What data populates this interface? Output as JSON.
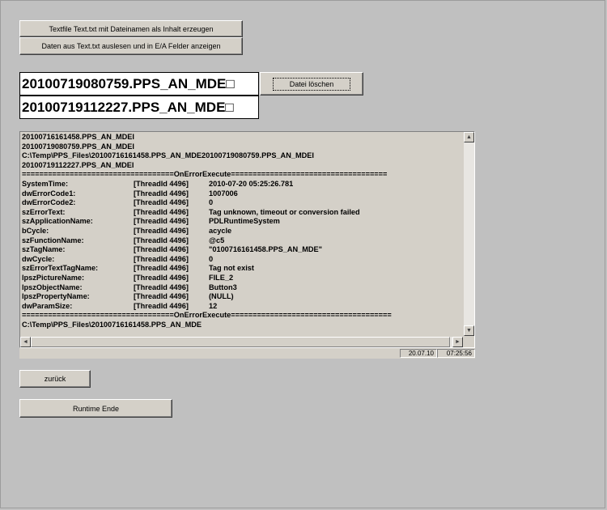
{
  "buttons": {
    "create_textfile": "Textfile Text.txt mit Dateinamen als Inhalt erzeugen",
    "read_textfile": "Daten aus Text.txt auslesen und in E/A Felder anzeigen",
    "delete_file": "Datei löschen",
    "back": "zurück",
    "runtime_end": "Runtime Ende"
  },
  "io_fields": {
    "file1": "20100719080759.PPS_AN_MDE□",
    "file2": "20100719112227.PPS_AN_MDE□"
  },
  "log": {
    "header_lines": [
      "20100716161458.PPS_AN_MDEI",
      "20100719080759.PPS_AN_MDEI",
      "C:\\Temp\\PPS_Files\\20100716161458.PPS_AN_MDE20100719080759.PPS_AN_MDEI",
      "20100719112227.PPS_AN_MDEI",
      "===================================OnErrorExecute===================================="
    ],
    "entries": [
      {
        "key": "SystemTime:",
        "thread": "[ThreadId 4496]",
        "value": "2010-07-20 05:25:26.781"
      },
      {
        "key": "dwErrorCode1:",
        "thread": "[ThreadId 4496]",
        "value": "1007006"
      },
      {
        "key": "dwErrorCode2:",
        "thread": "[ThreadId 4496]",
        "value": "0"
      },
      {
        "key": "szErrorText:",
        "thread": "[ThreadId 4496]",
        "value": "Tag unknown, timeout or conversion failed"
      },
      {
        "key": "szApplicationName:",
        "thread": "[ThreadId 4496]",
        "value": "PDLRuntimeSystem"
      },
      {
        "key": "bCycle:",
        "thread": "[ThreadId 4496]",
        "value": "acycle"
      },
      {
        "key": "szFunctionName:",
        "thread": "[ThreadId 4496]",
        "value": "@c5"
      },
      {
        "key": "szTagName:",
        "thread": "[ThreadId 4496]",
        "value": "\"0100716161458.PPS_AN_MDE\""
      },
      {
        "key": "dwCycle:",
        "thread": "[ThreadId 4496]",
        "value": "0"
      },
      {
        "key": "szErrorTextTagName:",
        "thread": "[ThreadId 4496]",
        "value": "Tag not exist"
      },
      {
        "key": "lpszPictureName:",
        "thread": "[ThreadId 4496]",
        "value": "FILE_2"
      },
      {
        "key": "lpszObjectName:",
        "thread": "[ThreadId 4496]",
        "value": "Button3"
      },
      {
        "key": "lpszPropertyName:",
        "thread": "[ThreadId 4496]",
        "value": "(NULL)"
      },
      {
        "key": "dwParamSize:",
        "thread": "[ThreadId 4496]",
        "value": "12"
      }
    ],
    "footer_lines": [
      "===================================OnErrorExecute=====================================",
      "C:\\Temp\\PPS_Files\\20100716161458.PPS_AN_MDE"
    ]
  },
  "status": {
    "date": "20.07.10",
    "time": "07:25:56"
  },
  "icons": {
    "scroll_up": "arrow-up",
    "scroll_down": "arrow-down",
    "scroll_left": "arrow-left",
    "scroll_right": "arrow-right"
  }
}
